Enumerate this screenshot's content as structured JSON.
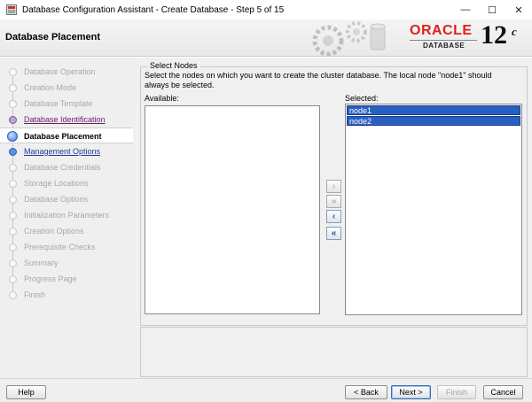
{
  "window": {
    "title": "Database Configuration Assistant - Create Database - Step 5 of 15",
    "minimize": "—",
    "maximize": "☐",
    "close": "✕"
  },
  "header": {
    "title": "Database Placement",
    "logo_brand": "ORACLE",
    "logo_product": "DATABASE",
    "logo_version": "12",
    "logo_version_suffix": "c"
  },
  "steps": [
    {
      "label": "Database Operation",
      "state": "disabled"
    },
    {
      "label": "Creation Mode",
      "state": "disabled"
    },
    {
      "label": "Database Template",
      "state": "disabled"
    },
    {
      "label": "Database Identification",
      "state": "visited"
    },
    {
      "label": "Database Placement",
      "state": "current"
    },
    {
      "label": "Management Options",
      "state": "next"
    },
    {
      "label": "Database Credentials",
      "state": "disabled"
    },
    {
      "label": "Storage Locations",
      "state": "disabled"
    },
    {
      "label": "Database Options",
      "state": "disabled"
    },
    {
      "label": "Initialization Parameters",
      "state": "disabled"
    },
    {
      "label": "Creation Options",
      "state": "disabled"
    },
    {
      "label": "Prerequisite Checks",
      "state": "disabled"
    },
    {
      "label": "Summary",
      "state": "disabled"
    },
    {
      "label": "Progress Page",
      "state": "disabled"
    },
    {
      "label": "Finish",
      "state": "disabled"
    }
  ],
  "select_nodes": {
    "legend": "Select Nodes",
    "instruction": "Select the nodes on which you want to create the cluster database. The local node \"node1\" should always be selected.",
    "available_label": "Available:",
    "selected_label": "Selected:",
    "available_items": [],
    "selected_items": [
      "node1",
      "node2"
    ],
    "move_buttons": {
      "move_right": "›",
      "move_all_right": "»",
      "move_left": "‹",
      "move_all_left": "«"
    }
  },
  "footer": {
    "help": "Help",
    "back": "< Back",
    "next": "Next >",
    "finish": "Finish",
    "cancel": "Cancel"
  },
  "colors": {
    "oracle_red": "#e0201b",
    "selection_blue": "#2a5fc2",
    "visited_link": "#6a1b6a",
    "next_link": "#1a3a9a"
  }
}
